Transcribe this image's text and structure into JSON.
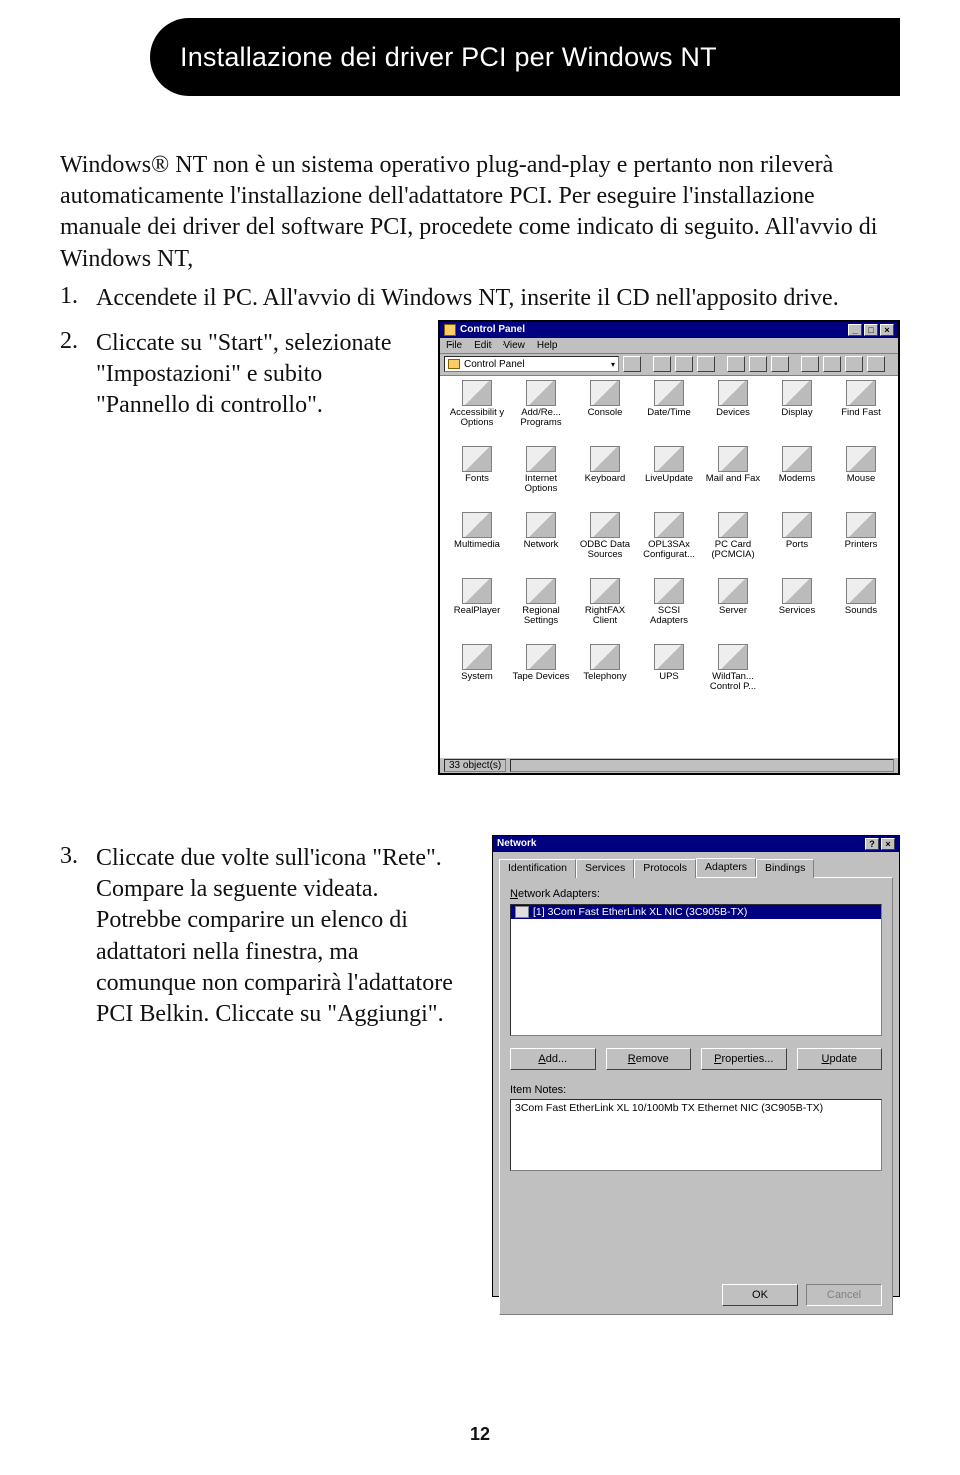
{
  "header": {
    "title": "Installazione dei driver PCI per Windows NT"
  },
  "intro": "Windows® NT non è un sistema operativo plug-and-play e pertanto non rileverà automaticamente l'installazione dell'adattatore PCI. Per eseguire l'installazione manuale dei driver del software PCI, procedete come indicato di seguito. All'avvio di Windows NT,",
  "step1": {
    "num": "1.",
    "text": "Accendete il PC. All'avvio di Windows NT, inserite il CD nell'apposito drive."
  },
  "step2": {
    "num": "2.",
    "text": "Cliccate su \"Start\", selezionate \"Impostazioni\" e subito \"Pannello di controllo\"."
  },
  "step3": {
    "num": "3.",
    "text": "Cliccate due volte sull'icona \"Rete\". Compare la seguente videata. Potrebbe comparire un elenco di adattatori nella finestra, ma comunque non comparirà l'adattatore PCI Belkin. Cliccate su \"Aggiungi\"."
  },
  "cp": {
    "title": "Control Panel",
    "menu": [
      "File",
      "Edit",
      "View",
      "Help"
    ],
    "addr_label": "Control Panel",
    "items": [
      "Accessibilit y Options",
      "Add/Re... Programs",
      "Console",
      "Date/Time",
      "Devices",
      "Display",
      "Find Fast",
      "Fonts",
      "Internet Options",
      "Keyboard",
      "LiveUpdate",
      "Mail and Fax",
      "Modems",
      "Mouse",
      "Multimedia",
      "Network",
      "ODBC Data Sources",
      "OPL3SAx Configurat...",
      "PC Card (PCMCIA)",
      "Ports",
      "Printers",
      "RealPlayer",
      "Regional Settings",
      "RightFAX Client",
      "SCSI Adapters",
      "Server",
      "Services",
      "Sounds",
      "System",
      "Tape Devices",
      "Telephony",
      "UPS",
      "WildTan... Control P..."
    ],
    "status": "33 object(s)"
  },
  "net": {
    "title": "Network",
    "tabs": [
      "Identification",
      "Services",
      "Protocols",
      "Adapters",
      "Bindings"
    ],
    "active_tab": "Adapters",
    "list_label": "Network Adapters:",
    "list_item": "[1] 3Com Fast EtherLink XL NIC (3C905B-TX)",
    "buttons": [
      "Add...",
      "Remove",
      "Properties...",
      "Update"
    ],
    "notes_label": "Item Notes:",
    "notes_value": "3Com Fast EtherLink XL 10/100Mb TX Ethernet NIC (3C905B-TX)",
    "ok": "OK",
    "cancel": "Cancel"
  },
  "page_number": "12"
}
